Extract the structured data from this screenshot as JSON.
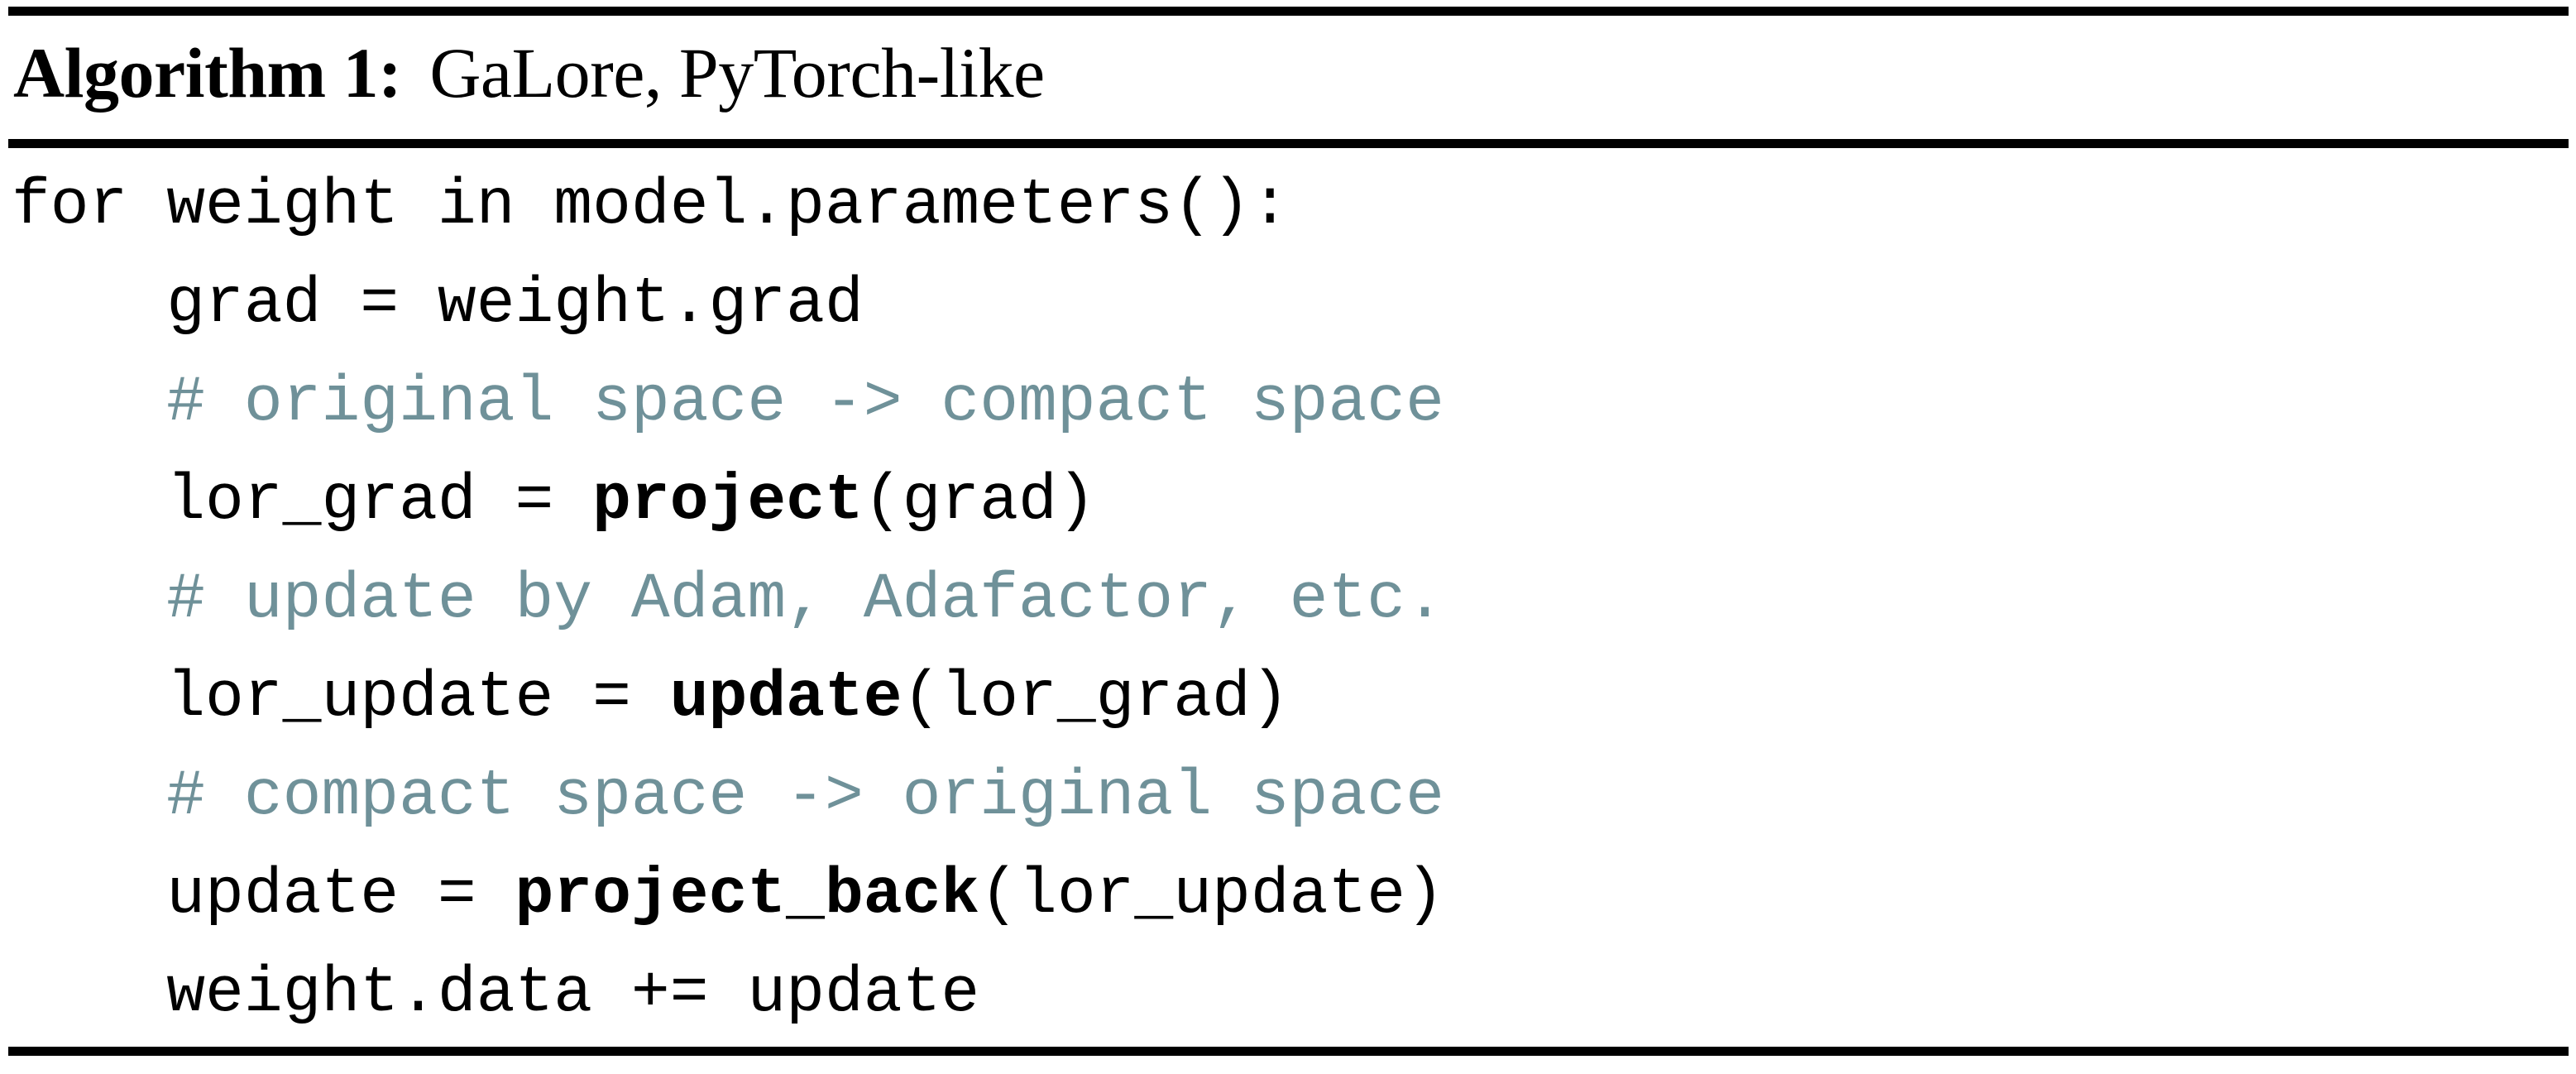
{
  "caption": {
    "label": "Algorithm 1:",
    "title": "GaLore, PyTorch-like"
  },
  "rules": {
    "color": "#000000",
    "count": 3
  },
  "colors": {
    "comment": "#6f9199",
    "code": "#000000",
    "background": "#ffffff"
  },
  "code": {
    "language": "python",
    "lines": [
      {
        "indent": "",
        "segments": [
          {
            "kind": "plain",
            "text": "for weight in model.parameters():"
          }
        ],
        "plain_text": "for weight in model.parameters():"
      },
      {
        "indent": "    ",
        "segments": [
          {
            "kind": "plain",
            "text": "    grad = weight.grad"
          }
        ],
        "plain_text": "    grad = weight.grad"
      },
      {
        "indent": "    ",
        "segments": [
          {
            "kind": "comment",
            "text": "    # original space -> compact space"
          }
        ],
        "plain_text": "    # original space -> compact space"
      },
      {
        "indent": "    ",
        "segments": [
          {
            "kind": "plain",
            "text": "    lor_grad = "
          },
          {
            "kind": "fn",
            "text": "project"
          },
          {
            "kind": "plain",
            "text": "(grad)"
          }
        ],
        "plain_text": "    lor_grad = project(grad)"
      },
      {
        "indent": "    ",
        "segments": [
          {
            "kind": "comment",
            "text": "    # update by Adam, Adafactor, etc."
          }
        ],
        "plain_text": "    # update by Adam, Adafactor, etc."
      },
      {
        "indent": "    ",
        "segments": [
          {
            "kind": "plain",
            "text": "    lor_update = "
          },
          {
            "kind": "fn",
            "text": "update"
          },
          {
            "kind": "plain",
            "text": "(lor_grad)"
          }
        ],
        "plain_text": "    lor_update = update(lor_grad)"
      },
      {
        "indent": "    ",
        "segments": [
          {
            "kind": "comment",
            "text": "    # compact space -> original space"
          }
        ],
        "plain_text": "    # compact space -> original space"
      },
      {
        "indent": "    ",
        "segments": [
          {
            "kind": "plain",
            "text": "    update = "
          },
          {
            "kind": "fn",
            "text": "project_back"
          },
          {
            "kind": "plain",
            "text": "(lor_update)"
          }
        ],
        "plain_text": "    update = project_back(lor_update)"
      },
      {
        "indent": "    ",
        "segments": [
          {
            "kind": "plain",
            "text": "    weight.data += update"
          }
        ],
        "plain_text": "    weight.data += update"
      }
    ]
  }
}
